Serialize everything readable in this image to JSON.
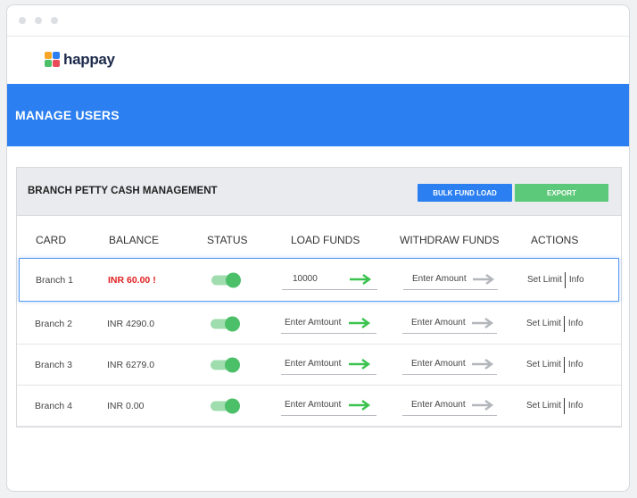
{
  "brand": {
    "name": "happay"
  },
  "banner": {
    "title": "MANAGE USERS"
  },
  "panel": {
    "title": "BRANCH PETTY CASH MANAGEMENT",
    "bulk_label": "BULK FUND LOAD",
    "export_label": "EXPORT"
  },
  "columns": {
    "card": "CARD",
    "balance": "BALANCE",
    "status": "STATUS",
    "load": "LOAD FUNDS",
    "withdraw": "WITHDRAW FUNDS",
    "actions": "ACTIONS"
  },
  "rows": [
    {
      "card": "Branch 1",
      "balance": "INR 60.00 !",
      "status": "on",
      "load_value": "10000",
      "withdraw_placeholder": "Enter Amount",
      "set_limit": "Set Limit",
      "info": "Info"
    },
    {
      "card": "Branch 2",
      "balance": "INR 4290.0",
      "status": "on",
      "load_value": "Enter Amtount",
      "withdraw_placeholder": "Enter Amount",
      "set_limit": "Set Limit",
      "info": "Info"
    },
    {
      "card": "Branch 3",
      "balance": "INR 6279.0",
      "status": "on",
      "load_value": "Enter Amtount",
      "withdraw_placeholder": "Enter Amount",
      "set_limit": "Set Limit",
      "info": "Info"
    },
    {
      "card": "Branch 4",
      "balance": "INR 0.00",
      "status": "on",
      "load_value": "Enter Amtount",
      "withdraw_placeholder": "Enter Amount",
      "set_limit": "Set Limit",
      "info": "Info"
    }
  ],
  "colors": {
    "accent": "#2b7ff0",
    "export": "#5cc879",
    "toggle_on": "#4cbf69",
    "load_arrow": "#3cc24f",
    "withdraw_arrow": "#b3b6bb",
    "low_balance": "#e02020"
  }
}
